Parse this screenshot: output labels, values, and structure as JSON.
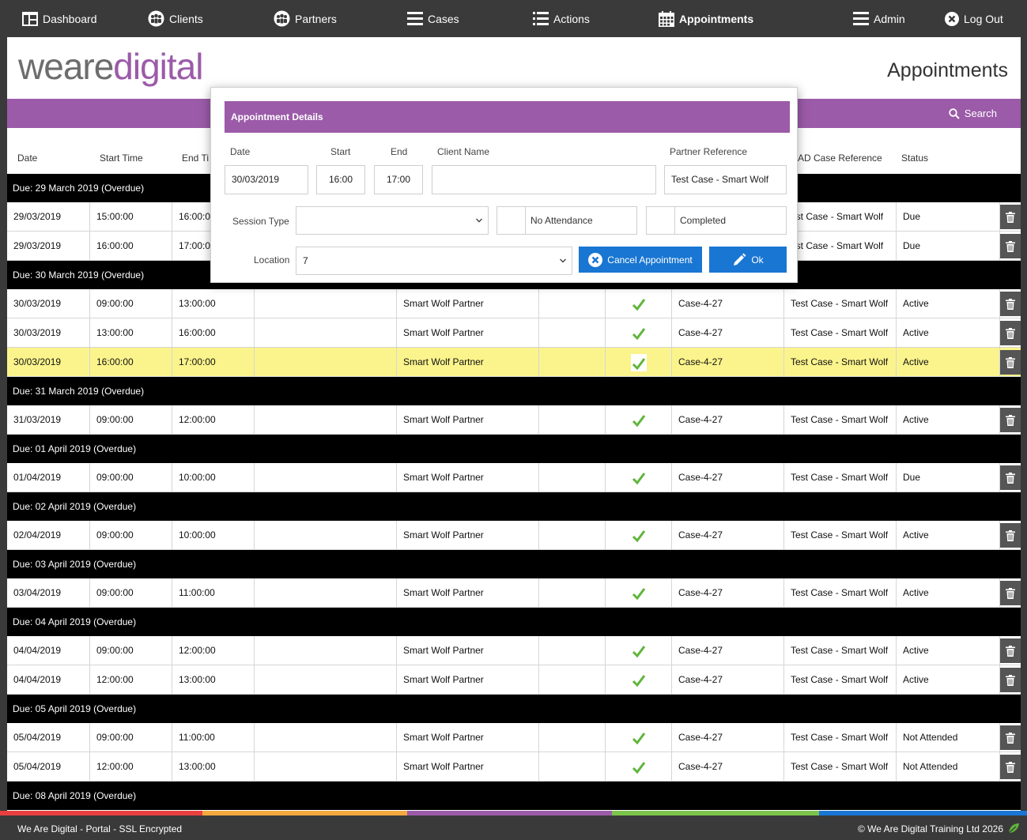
{
  "nav": {
    "dashboard": "Dashboard",
    "clients": "Clients",
    "partners": "Partners",
    "cases": "Cases",
    "actions": "Actions",
    "appointments": "Appointments",
    "admin": "Admin",
    "logout": "Log Out"
  },
  "logo": {
    "we": "we",
    "are": "are",
    "digital": "digital"
  },
  "page_title": "Appointments",
  "search_label": "Search",
  "columns": {
    "date": "Date",
    "start": "Start Time",
    "end": "End Ti",
    "case_ref": "AD Case Reference",
    "status": "Status"
  },
  "groups": [
    {
      "label": "Due: 29 March 2019 (Overdue)",
      "rows": [
        {
          "date": "29/03/2019",
          "start": "15:00:00",
          "end": "16:00:0",
          "client": "",
          "partner": "",
          "blank": "",
          "check": false,
          "case": "",
          "ref": "est Case - Smart Wolf",
          "status": "Due"
        },
        {
          "date": "29/03/2019",
          "start": "16:00:00",
          "end": "17:00:0",
          "client": "",
          "partner": "",
          "blank": "",
          "check": false,
          "case": "",
          "ref": "est Case - Smart Wolf",
          "status": "Due"
        }
      ]
    },
    {
      "label": "Due: 30 March 2019 (Overdue)",
      "rows": [
        {
          "date": "30/03/2019",
          "start": "09:00:00",
          "end": "13:00:00",
          "client": "",
          "partner": "Smart Wolf Partner",
          "blank": "",
          "check": true,
          "case": "Case-4-27",
          "ref": "Test Case - Smart Wolf",
          "status": "Active"
        },
        {
          "date": "30/03/2019",
          "start": "13:00:00",
          "end": "16:00:00",
          "client": "",
          "partner": "Smart Wolf Partner",
          "blank": "",
          "check": true,
          "case": "Case-4-27",
          "ref": "Test Case - Smart Wolf",
          "status": "Active"
        },
        {
          "date": "30/03/2019",
          "start": "16:00:00",
          "end": "17:00:00",
          "client": "",
          "partner": "Smart Wolf Partner",
          "blank": "",
          "check": true,
          "case": "Case-4-27",
          "ref": "Test Case - Smart Wolf",
          "status": "Active",
          "highlight": true
        }
      ]
    },
    {
      "label": "Due: 31 March 2019 (Overdue)",
      "rows": [
        {
          "date": "31/03/2019",
          "start": "09:00:00",
          "end": "12:00:00",
          "client": "",
          "partner": "Smart Wolf Partner",
          "blank": "",
          "check": true,
          "case": "Case-4-27",
          "ref": "Test Case - Smart Wolf",
          "status": "Active"
        }
      ]
    },
    {
      "label": "Due: 01 April 2019 (Overdue)",
      "rows": [
        {
          "date": "01/04/2019",
          "start": "09:00:00",
          "end": "10:00:00",
          "client": "",
          "partner": "Smart Wolf Partner",
          "blank": "",
          "check": true,
          "case": "Case-4-27",
          "ref": "Test Case - Smart Wolf",
          "status": "Due"
        }
      ]
    },
    {
      "label": "Due: 02 April 2019 (Overdue)",
      "rows": [
        {
          "date": "02/04/2019",
          "start": "09:00:00",
          "end": "10:00:00",
          "client": "",
          "partner": "Smart Wolf Partner",
          "blank": "",
          "check": true,
          "case": "Case-4-27",
          "ref": "Test Case - Smart Wolf",
          "status": "Active"
        }
      ]
    },
    {
      "label": "Due: 03 April 2019 (Overdue)",
      "rows": [
        {
          "date": "03/04/2019",
          "start": "09:00:00",
          "end": "11:00:00",
          "client": "",
          "partner": "Smart Wolf Partner",
          "blank": "",
          "check": true,
          "case": "Case-4-27",
          "ref": "Test Case - Smart Wolf",
          "status": "Active"
        }
      ]
    },
    {
      "label": "Due: 04 April 2019 (Overdue)",
      "rows": [
        {
          "date": "04/04/2019",
          "start": "09:00:00",
          "end": "12:00:00",
          "client": "",
          "partner": "Smart Wolf Partner",
          "blank": "",
          "check": true,
          "case": "Case-4-27",
          "ref": "Test Case - Smart Wolf",
          "status": "Active"
        },
        {
          "date": "04/04/2019",
          "start": "12:00:00",
          "end": "13:00:00",
          "client": "",
          "partner": "Smart Wolf Partner",
          "blank": "",
          "check": true,
          "case": "Case-4-27",
          "ref": "Test Case - Smart Wolf",
          "status": "Active"
        }
      ]
    },
    {
      "label": "Due: 05 April 2019 (Overdue)",
      "rows": [
        {
          "date": "05/04/2019",
          "start": "09:00:00",
          "end": "11:00:00",
          "client": "",
          "partner": "Smart Wolf Partner",
          "blank": "",
          "check": true,
          "case": "Case-4-27",
          "ref": "Test Case - Smart Wolf",
          "status": "Not Attended"
        },
        {
          "date": "05/04/2019",
          "start": "12:00:00",
          "end": "13:00:00",
          "client": "",
          "partner": "Smart Wolf Partner",
          "blank": "",
          "check": true,
          "case": "Case-4-27",
          "ref": "Test Case - Smart Wolf",
          "status": "Not Attended"
        }
      ]
    },
    {
      "label": "Due: 08 April 2019 (Overdue)",
      "rows": []
    }
  ],
  "popup": {
    "title": "Appointment Details",
    "date_label": "Date",
    "date_value": "30/03/2019",
    "start_label": "Start",
    "start_value": "16:00",
    "end_label": "End",
    "end_value": "17:00",
    "client_label": "Client Name",
    "client_value": "",
    "partner_label": "Partner Reference",
    "partner_value": "Test Case - Smart Wolf",
    "session_label": "Session Type",
    "session_value": "",
    "no_attendance_label": "No Attendance",
    "completed_label": "Completed",
    "location_label": "Location",
    "location_value": "7",
    "cancel_label": "Cancel Appointment",
    "ok_label": "Ok"
  },
  "footer": {
    "left": "We Are Digital - Portal - SSL Encrypted",
    "right": "© We Are Digital Training Ltd 2026"
  },
  "colors": {
    "nav_bg": "#3a3a3a",
    "brand_purple": "#9b5ba8",
    "highlight_row": "#fbf48c",
    "check_green": "#5fb53b",
    "button_blue": "#1976d2",
    "rainbow": [
      "#e8403f",
      "#f5a93f",
      "#9b5ba8",
      "#7cc54a",
      "#1976d2"
    ]
  }
}
